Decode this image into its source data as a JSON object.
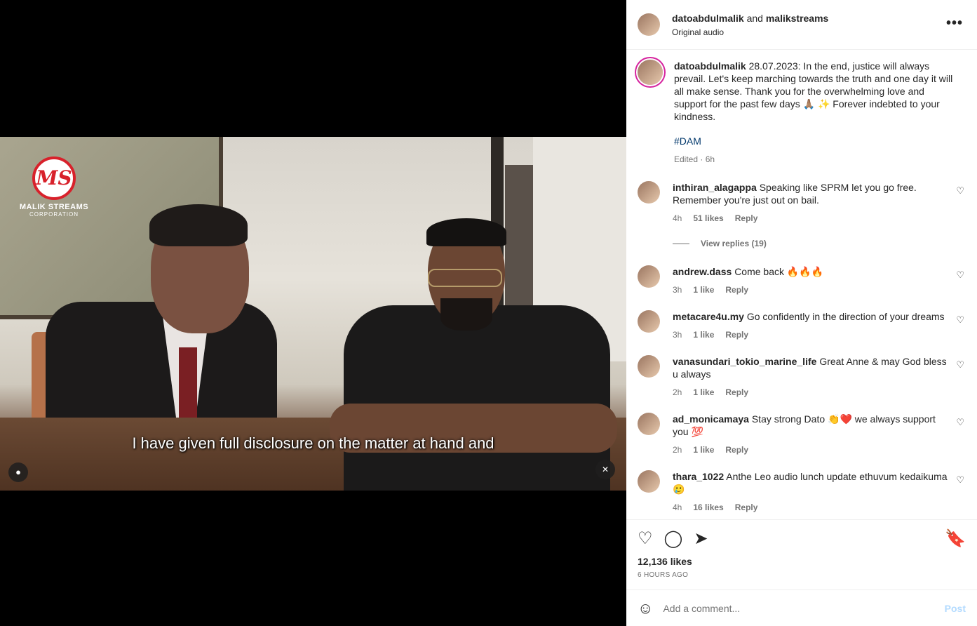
{
  "header": {
    "user1": "datoabdulmalik",
    "conjunction": "and",
    "user2": "malikstreams",
    "audio": "Original audio",
    "more_icon": "more-icon"
  },
  "video": {
    "logo_mark": "MS",
    "logo_name": "MALIK STREAMS",
    "logo_sub": "CORPORATION",
    "subtitle": "I have given full disclosure on the matter at hand and",
    "tag_icon": "person-icon",
    "mute_icon": "muted-speaker-icon"
  },
  "caption": {
    "user": "datoabdulmalik",
    "text": "28.07.2023: In the end, justice will always prevail. Let's keep marching towards the truth and one day it will all make sense. Thank you for the overwhelming love and support for the past few days 🙏🏽 ✨ Forever indebted to your kindness.",
    "hashtag": "#DAM",
    "edited": "Edited · 6h"
  },
  "comments": [
    {
      "user": "inthiran_alagappa",
      "text": "Speaking like SPRM let you go free. Remember you're just out on bail.",
      "time": "4h",
      "likes": "51 likes",
      "reply": "Reply"
    },
    {
      "user": "andrew.dass",
      "text": "Come back 🔥🔥🔥",
      "time": "3h",
      "likes": "1 like",
      "reply": "Reply"
    },
    {
      "user": "metacare4u.my",
      "text": "Go confidently in the direction of your dreams",
      "time": "3h",
      "likes": "1 like",
      "reply": "Reply"
    },
    {
      "user": "vanasundari_tokio_marine_life",
      "text": "Great Anne & may God bless u always",
      "time": "2h",
      "likes": "1 like",
      "reply": "Reply"
    },
    {
      "user": "ad_monicamaya",
      "text": "Stay strong Dato 👏❤️ we always support you 💯",
      "time": "2h",
      "likes": "1 like",
      "reply": "Reply"
    },
    {
      "user": "thara_1022",
      "text": "Anthe Leo audio lunch update ethuvum kedaikuma 🥲",
      "time": "4h",
      "likes": "16 likes",
      "reply": "Reply"
    }
  ],
  "view_replies": "View replies (19)",
  "actions": {
    "like_icon": "♡",
    "comment_icon": "◯",
    "share_icon": "➤",
    "save_icon": "🔖"
  },
  "likes": "12,136 likes",
  "posted": "6 HOURS AGO",
  "add_comment": {
    "emoji_icon": "☺",
    "placeholder": "Add a comment...",
    "post_label": "Post"
  }
}
